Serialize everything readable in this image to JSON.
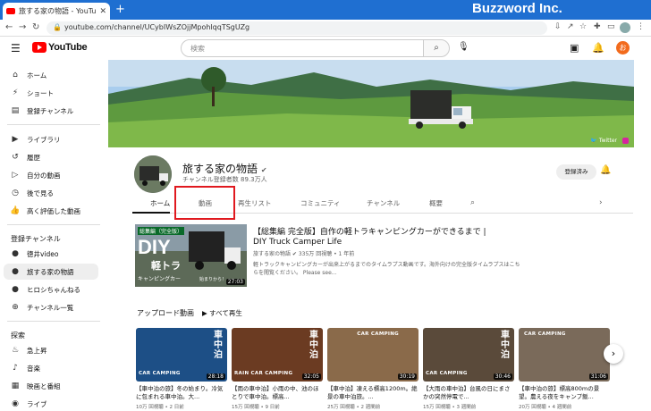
{
  "browser": {
    "tab_title": "旅する家の物語 - YouTube",
    "brand": "Buzzword Inc.",
    "url": "youtube.com/channel/UCybIWsZOjjMpohlqqTSgUZg",
    "profile": "ほか"
  },
  "header": {
    "logo": "YouTube",
    "search_placeholder": "検索",
    "avatar": "お"
  },
  "sidebar": {
    "items": [
      {
        "label": "ホーム",
        "icon": "home-icon"
      },
      {
        "label": "ショート",
        "icon": "shorts-icon"
      },
      {
        "label": "登録チャンネル",
        "icon": "subscriptions-icon"
      }
    ],
    "library": [
      {
        "label": "ライブラリ",
        "icon": "library-icon"
      },
      {
        "label": "履歴",
        "icon": "history-icon"
      },
      {
        "label": "自分の動画",
        "icon": "my-videos-icon"
      },
      {
        "label": "後で見る",
        "icon": "watch-later-icon"
      },
      {
        "label": "高く評価した動画",
        "icon": "liked-icon"
      }
    ],
    "subs_heading": "登録チャンネル",
    "subs": [
      {
        "label": "徳井video"
      },
      {
        "label": "旅する家の物語"
      },
      {
        "label": "ヒロシちゃんねる"
      },
      {
        "label": "チャンネル一覧"
      }
    ],
    "explore_heading": "探索",
    "explore": [
      {
        "label": "急上昇",
        "icon": "trending-icon"
      },
      {
        "label": "音楽",
        "icon": "music-icon"
      },
      {
        "label": "映画と番組",
        "icon": "movies-icon"
      },
      {
        "label": "ライブ",
        "icon": "live-icon"
      }
    ]
  },
  "channel": {
    "name": "旅する家の物語",
    "subscribers": "チャンネル登録者数 89.3万人",
    "subscribed": "登録済み",
    "social": "Twitter",
    "tabs": [
      "ホーム",
      "動画",
      "再生リスト",
      "コミュニティ",
      "チャンネル",
      "概要"
    ]
  },
  "featured": {
    "title": "【総集編 完全版】自作の軽トラキャンピングカーができるまで |",
    "subtitle": "DIY Truck Camper Life",
    "meta": "旅する家の物語 ✔  335万 回視聴 • 1 年前",
    "desc": "軽トラックキャンピングカーが出来上がるまでのタイムラプス動画です。海外向けの完全版タイムラプスはこちらを閲覧ください。 Please see...",
    "duration": "27:03",
    "thumb_big": "DIY",
    "thumb_tag": "総集編（完全版）",
    "thumb_sub": "軽トラ",
    "thumb_sub2": "キャンピングカー",
    "thumb_caption": "始まりから！"
  },
  "uploads": {
    "heading": "アップロード動画",
    "play_all": "すべて再生"
  },
  "videos": [
    {
      "title": "【車中泊の旅】冬の始まり。冷気に包まれる車中泊。大...",
      "meta": "10万 回視聴 • 2 日前",
      "duration": "28:18",
      "tag": "CAR CAMPING",
      "vtext": "車中泊"
    },
    {
      "title": "【雨の車中泊】小雨の中、池のほとりで車中泊。標高...",
      "meta": "15万 回視聴 • 9 日前",
      "duration": "32:05",
      "tag": "RAIN CAR CAMPING",
      "vtext": "車中泊"
    },
    {
      "title": "【車中泊】凍える標高1200m。絶景の車中泊旅。...",
      "meta": "25万 回視聴 • 2 週間前",
      "duration": "30:19",
      "tag": "CAR CAMPING",
      "vtext": ""
    },
    {
      "title": "【大雨の車中泊】台風の日にまさかの突然停電で...",
      "meta": "15万 回視聴 • 3 週間前",
      "duration": "30:46",
      "tag": "CAR CAMPING",
      "vtext": "車中泊"
    },
    {
      "title": "【車中泊の旅】標高800mの景望。農える夜をキャンプ飯...",
      "meta": "20万 回視聴 • 4 週間前",
      "duration": "31:06",
      "tag": "CAR CAMPING",
      "vtext": ""
    }
  ],
  "colors": {
    "accent": "#1f6fd1",
    "highlight": "#e0191f",
    "yt_red": "#ff0000"
  }
}
